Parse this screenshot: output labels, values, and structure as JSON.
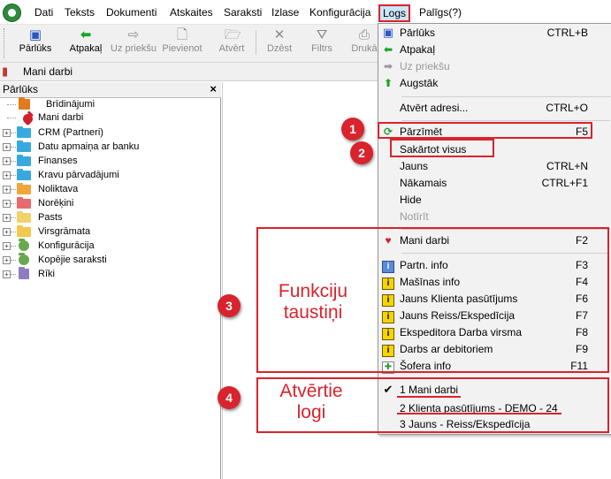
{
  "menubar": {
    "items": [
      "Dati",
      "Teksts",
      "Dokumenti",
      "Atskaites",
      "Saraksti",
      "Izlase",
      "Konfigurācija",
      "Logs",
      "Palīgs(?)"
    ],
    "active": "Logs"
  },
  "toolbar": {
    "buttons": [
      {
        "label": "Pārlūks",
        "icon": "browser-icon",
        "enabled": true
      },
      {
        "label": "Atpakaļ",
        "icon": "arrow-left-icon",
        "enabled": true
      },
      {
        "label": "Uz priekšu",
        "icon": "arrow-right-icon",
        "enabled": false
      },
      {
        "label": "Pievienot",
        "icon": "new-document-icon",
        "enabled": false
      },
      {
        "label": "Atvērt",
        "icon": "open-folder-icon",
        "enabled": false
      },
      {
        "label": "Dzēst",
        "icon": "delete-icon",
        "enabled": false
      },
      {
        "label": "Filtrs",
        "icon": "filter-icon",
        "enabled": false
      },
      {
        "label": "Drukā",
        "icon": "print-icon",
        "enabled": false
      }
    ]
  },
  "doc_tab": {
    "label": "Mani darbi"
  },
  "explorer": {
    "title": "Pārlūks",
    "close": "×",
    "items": [
      {
        "label": "Brīdinājumi",
        "color": "#e07b1f"
      },
      {
        "label": "Mani darbi",
        "color": "#d0202e"
      },
      {
        "label": "CRM (Partneri)",
        "color": "#38a9e0"
      },
      {
        "label": "Datu apmaiņa ar banku",
        "color": "#38a9e0"
      },
      {
        "label": "Finanses",
        "color": "#38a9e0"
      },
      {
        "label": "Kravu pārvadājumi",
        "color": "#38a9e0"
      },
      {
        "label": "Noliktava",
        "color": "#f0a63a"
      },
      {
        "label": "Norēķini",
        "color": "#e8696e"
      },
      {
        "label": "Pasts",
        "color": "#f2d36b"
      },
      {
        "label": "Virsgrāmata",
        "color": "#f2c94c"
      },
      {
        "label": "Konfigurācija",
        "color": "#6aa84f"
      },
      {
        "label": "Kopējie saraksti",
        "color": "#6aa84f"
      },
      {
        "label": "Rīki",
        "color": "#8e7cc3"
      }
    ]
  },
  "menu": {
    "items": [
      {
        "label": "Pārlūks",
        "shortcut": "CTRL+B",
        "icon": "browser-icon",
        "enabled": true
      },
      {
        "label": "Atpakaļ",
        "shortcut": "",
        "icon": "arrow-left-icon",
        "enabled": true
      },
      {
        "label": "Uz priekšu",
        "shortcut": "",
        "icon": "arrow-right-icon",
        "enabled": false
      },
      {
        "label": "Augstāk",
        "shortcut": "",
        "icon": "arrow-up-icon",
        "enabled": true
      },
      {
        "label": "Atvērt adresi...",
        "shortcut": "CTRL+O",
        "icon": "",
        "enabled": true
      },
      {
        "label": "Pārzīmēt",
        "shortcut": "F5",
        "icon": "refresh-icon",
        "enabled": true
      },
      {
        "label": "Sakārtot visus",
        "shortcut": "",
        "icon": "",
        "enabled": true
      },
      {
        "label": "Jauns",
        "shortcut": "CTRL+N",
        "icon": "",
        "enabled": true
      },
      {
        "label": "Nākamais",
        "shortcut": "CTRL+F1",
        "icon": "",
        "enabled": true
      },
      {
        "label": "Hide",
        "shortcut": "",
        "icon": "",
        "enabled": true
      },
      {
        "label": "Notīrīt",
        "shortcut": "",
        "icon": "",
        "enabled": false
      },
      {
        "label": "Mani darbi",
        "shortcut": "F2",
        "icon": "heart-icon",
        "enabled": true
      },
      {
        "label": "Partn. info",
        "shortcut": "F3",
        "icon": "partner-info-icon",
        "enabled": true
      },
      {
        "label": "Mašīnas info",
        "shortcut": "F4",
        "icon": "info-icon",
        "enabled": true
      },
      {
        "label": "Jauns Klienta pasūtījums",
        "shortcut": "F6",
        "icon": "info-icon",
        "enabled": true
      },
      {
        "label": "Jauns Reiss/Ekspedīcija",
        "shortcut": "F7",
        "icon": "info-icon",
        "enabled": true
      },
      {
        "label": "Ekspeditora Darba virsma",
        "shortcut": "F8",
        "icon": "info-icon",
        "enabled": true
      },
      {
        "label": "Darbs ar debitoriem",
        "shortcut": "F9",
        "icon": "info-icon",
        "enabled": true
      },
      {
        "label": "Šofera info",
        "shortcut": "F11",
        "icon": "driver-info-icon",
        "enabled": true
      },
      {
        "label": "1 Mani darbi",
        "shortcut": "",
        "icon": "check-icon",
        "enabled": true
      },
      {
        "label": "2 Klienta pasūtījums - DEMO  - 24",
        "shortcut": "",
        "icon": "",
        "enabled": true
      },
      {
        "label": "3 Jauns - Reiss/Ekspedīcija",
        "shortcut": "",
        "icon": "",
        "enabled": true
      }
    ]
  },
  "annotations": {
    "badges": [
      "1",
      "2",
      "3",
      "4"
    ],
    "label_3": [
      "Funkciju",
      "taustiņi"
    ],
    "label_4": [
      "Atvērtie",
      "logi"
    ],
    "accent": "#d9232d"
  }
}
